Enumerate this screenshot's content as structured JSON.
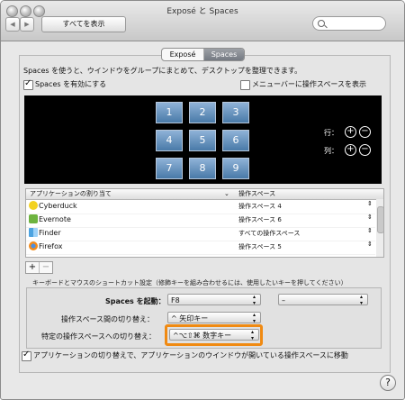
{
  "window": {
    "title": "Exposé と Spaces"
  },
  "toolbar": {
    "back_icon": "chevron-left-icon",
    "forward_icon": "chevron-right-icon",
    "show_all": "すべてを表示",
    "search_placeholder": ""
  },
  "tabs": [
    {
      "label": "Exposé",
      "selected": false
    },
    {
      "label": "Spaces",
      "selected": true
    }
  ],
  "description": "Spaces を使うと、ウインドウをグループにまとめて、デスクトップを整理できます。",
  "enable_spaces": {
    "label": "Spaces を有効にする",
    "checked": true
  },
  "menu_bar_spaces": {
    "label": "メニューバーに操作スペースを表示",
    "checked": false
  },
  "spaces_grid": [
    "1",
    "2",
    "3",
    "4",
    "5",
    "6",
    "7",
    "8",
    "9"
  ],
  "grid_controls": {
    "rows_label": "行：",
    "columns_label": "列："
  },
  "application_table": {
    "headers": [
      "アプリケーションの割り当て",
      "操作スペース"
    ],
    "rows": [
      {
        "app": "Cyberduck",
        "space": "操作スペース 4",
        "icon": "duck-icon"
      },
      {
        "app": "Evernote",
        "space": "操作スペース 6",
        "icon": "elephant-icon"
      },
      {
        "app": "Finder",
        "space": "すべての操作スペース",
        "icon": "finder-icon"
      },
      {
        "app": "Firefox",
        "space": "操作スペース 5",
        "icon": "firefox-icon"
      }
    ]
  },
  "list_buttons": {
    "plus": "+",
    "minus": "−"
  },
  "shortcut_section_title": "キーボードとマウスのショートカット設定（修飾キーを組み合わせるには、使用したいキーを押してください）",
  "shortcuts": {
    "activate_label": "Spaces を起動：",
    "activate_value": "F8",
    "activate_secondary_value": "–",
    "switch_label": "操作スペース間の切り替え：",
    "switch_value": "^ 矢印キー",
    "direct_label": "特定の操作スペースへの切り替え：",
    "direct_value": "^⌥⇧⌘ 数字キー"
  },
  "switch_application": {
    "label": "アプリケーションの切り替えで、アプリケーションのウインドウが開いている操作スペースに移動",
    "checked": true
  },
  "help": "?",
  "colors": {
    "highlight": "#f08a12",
    "selected_tab": "#7b8089",
    "space_tile": "#6f98c3"
  }
}
